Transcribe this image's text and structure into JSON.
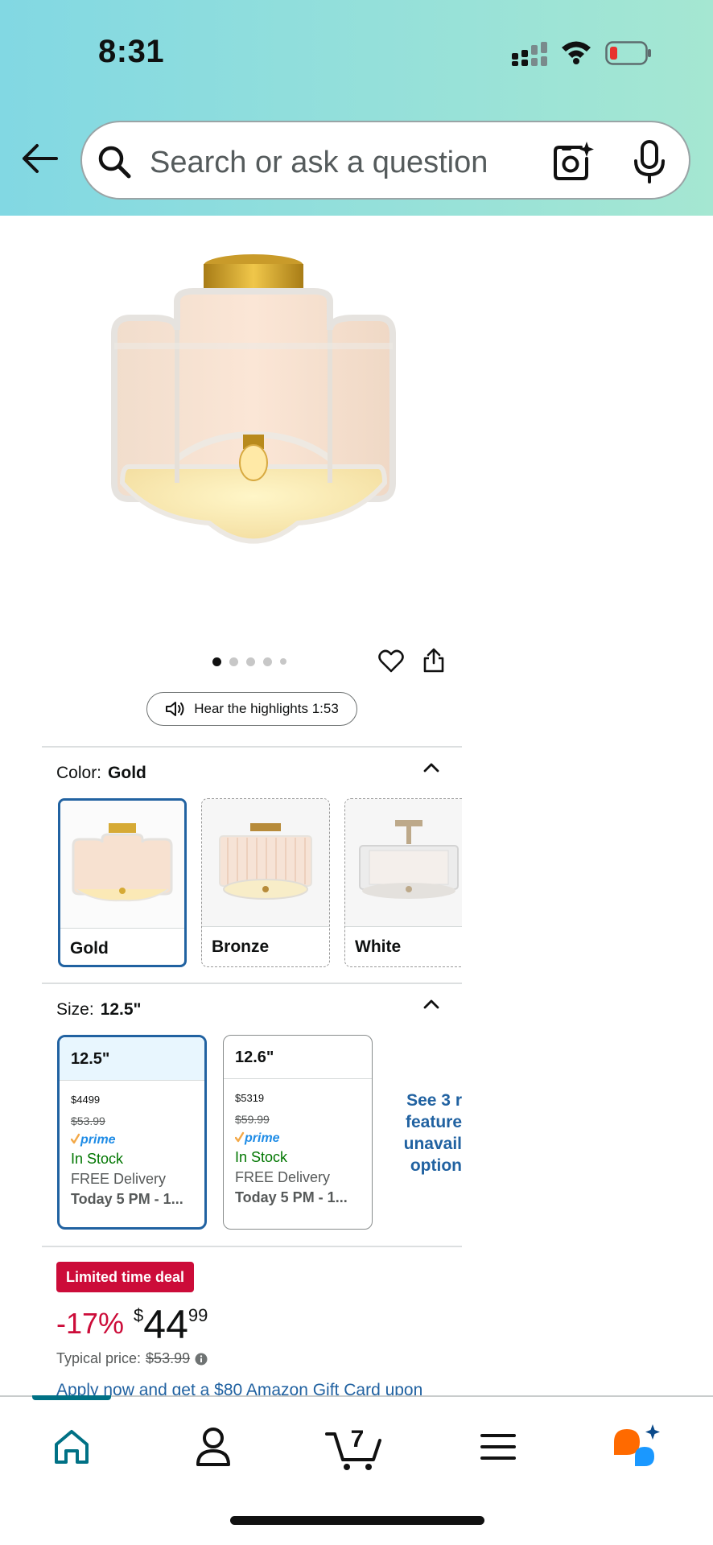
{
  "status_bar": {
    "time": "8:31"
  },
  "search": {
    "placeholder": "Search or ask a question"
  },
  "gallery": {
    "image_count": 5,
    "active_index": 0
  },
  "highlights": {
    "label": "Hear the highlights 1:53"
  },
  "color": {
    "label": "Color:",
    "selected": "Gold",
    "options": [
      {
        "name": "Gold"
      },
      {
        "name": "Bronze"
      },
      {
        "name": "White"
      }
    ]
  },
  "size": {
    "label": "Size:",
    "selected": "12.5\"",
    "options": [
      {
        "size": "12.5\"",
        "price_whole": "$44",
        "price_frac": "99",
        "typical": "$53.99",
        "prime": "prime",
        "stock": "In Stock",
        "delivery": "FREE Delivery",
        "date": "Today 5 PM - 1..."
      },
      {
        "size": "12.6\"",
        "price_whole": "$53",
        "price_frac": "19",
        "typical": "$59.99",
        "prime": "prime",
        "stock": "In Stock",
        "delivery": "FREE Delivery",
        "date": "Today 5 PM - 1..."
      }
    ],
    "see_more": [
      "See 3 r",
      "feature",
      "unavail",
      "option"
    ]
  },
  "deal": {
    "badge": "Limited time deal",
    "discount": "-17%",
    "currency": "$",
    "whole": "44",
    "fraction": "99",
    "typical_label": "Typical price:",
    "typical_value": "$53.99",
    "apply_text": "Apply now and get a $80 Amazon Gift Card upon"
  },
  "bottom_nav": {
    "items": [
      "home-icon",
      "account-icon",
      "cart-icon",
      "menu-icon",
      "rufus-icon"
    ],
    "cart_count": "7",
    "active": "home"
  },
  "colors": {
    "accent_blue": "#2162a1",
    "deal_red": "#cc0c39",
    "teal": "#007185",
    "in_stock_green": "#007600"
  }
}
